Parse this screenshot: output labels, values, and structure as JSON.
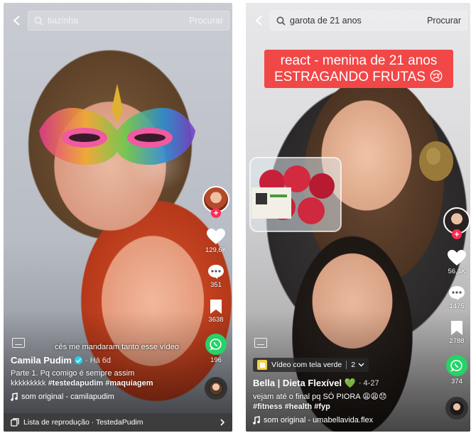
{
  "left": {
    "search": {
      "query": "tiazinha",
      "button": "Procurar"
    },
    "stats": {
      "likes": "129,6K",
      "comments": "351",
      "saves": "3638",
      "shares": "196"
    },
    "subtitle": "cês me mandaram tanto esse vídeo",
    "author": {
      "name": "Camila Pudim",
      "meta": "· Há 6d"
    },
    "description": {
      "line1": "Parte 1. Pq comigo é sempre assim",
      "line2_text": "kkkkkkkkk",
      "line2_tags": "#testedapudim #maquiagem"
    },
    "sound": "som original - camilapudim",
    "playlist": "Lista de reprodução · TestedaPudim"
  },
  "right": {
    "search": {
      "query": "garota de 21 anos",
      "button": "Procurar"
    },
    "banner": {
      "line1": "react - menina de 21 anos",
      "line2": "ESTRAGANDO FRUTAS 😢"
    },
    "stats": {
      "likes": "56,4K",
      "comments": "1475",
      "saves": "2788",
      "shares": "374"
    },
    "effect": {
      "label": "Vídeo com tela verde",
      "count": "2"
    },
    "author": {
      "name": "Bella | Dieta Flexível 💚",
      "meta": "· 4-27"
    },
    "description": {
      "line1": "vejam até o final pq SÓ PIORA 😩😩😞",
      "tags": "#fitness #health #fyp"
    },
    "sound": "som original - umabellavida.flex"
  },
  "icons": {
    "back": "chevron-left-icon",
    "search": "search-icon",
    "like": "heart-icon",
    "comment": "comment-icon",
    "save": "bookmark-icon",
    "share": "whatsapp-icon",
    "music": "music-note-icon",
    "playlist": "playlist-icon",
    "captions": "captions-icon"
  },
  "colors": {
    "follow_badge": "#fe2c55",
    "whatsapp": "#25d366",
    "banner": "#f24747",
    "verified": "#20d5ec"
  }
}
